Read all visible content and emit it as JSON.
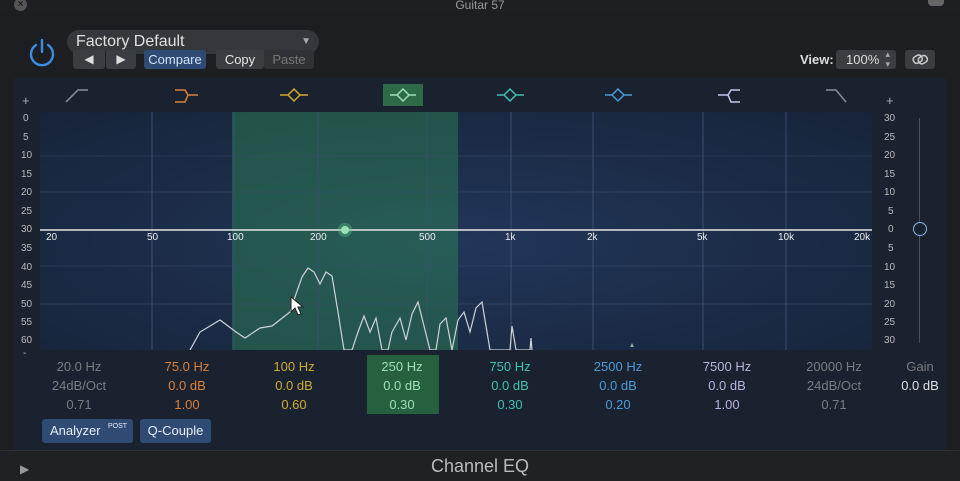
{
  "window": {
    "title": "Guitar 57"
  },
  "header": {
    "preset": "Factory Default",
    "buttons": {
      "prev": "◀",
      "next": "▶",
      "compare": "Compare",
      "copy": "Copy",
      "paste": "Paste"
    },
    "view_label": "View:",
    "view_value": "100%"
  },
  "graph": {
    "left_scale": [
      "0",
      "5",
      "10",
      "15",
      "20",
      "25",
      "30",
      "35",
      "40",
      "45",
      "50",
      "55",
      "60",
      "-"
    ],
    "right_scale": [
      "30",
      "25",
      "20",
      "15",
      "10",
      "5",
      "0",
      "5",
      "10",
      "15",
      "20",
      "25",
      "30"
    ],
    "freq_labels": [
      "20",
      "50",
      "100",
      "200",
      "500",
      "1k",
      "2k",
      "5k",
      "10k",
      "20k"
    ],
    "plus_left": "+",
    "plus_right": "+"
  },
  "bands": [
    {
      "freq": "20.0 Hz",
      "gain": "24dB/Oct",
      "q": "0.71",
      "color": "#7a7d82",
      "type": "low-cut"
    },
    {
      "freq": "75.0 Hz",
      "gain": "0.0 dB",
      "q": "1.00",
      "color": "#d9803a",
      "type": "low-shelf"
    },
    {
      "freq": "100 Hz",
      "gain": "0.0 dB",
      "q": "0.60",
      "color": "#cfaa2f",
      "type": "bell"
    },
    {
      "freq": "250 Hz",
      "gain": "0.0 dB",
      "q": "0.30",
      "color": "#7fcf9a",
      "type": "bell",
      "selected": true
    },
    {
      "freq": "750 Hz",
      "gain": "0.0 dB",
      "q": "0.30",
      "color": "#3fc0b0",
      "type": "bell"
    },
    {
      "freq": "2500 Hz",
      "gain": "0.0 dB",
      "q": "0.20",
      "color": "#4a9bd8",
      "type": "bell"
    },
    {
      "freq": "7500 Hz",
      "gain": "0.0 dB",
      "q": "1.00",
      "color": "#b8b4de",
      "type": "high-shelf"
    },
    {
      "freq": "20000 Hz",
      "gain": "24dB/Oct",
      "q": "0.71",
      "color": "#7a7d82",
      "type": "high-cut"
    }
  ],
  "gain": {
    "label": "Gain",
    "value": "0.0 dB"
  },
  "controls": {
    "analyzer": "Analyzer",
    "analyzer_badge": "POST",
    "qcouple": "Q-Couple"
  },
  "footer": {
    "title": "Channel EQ",
    "play": "▶"
  }
}
